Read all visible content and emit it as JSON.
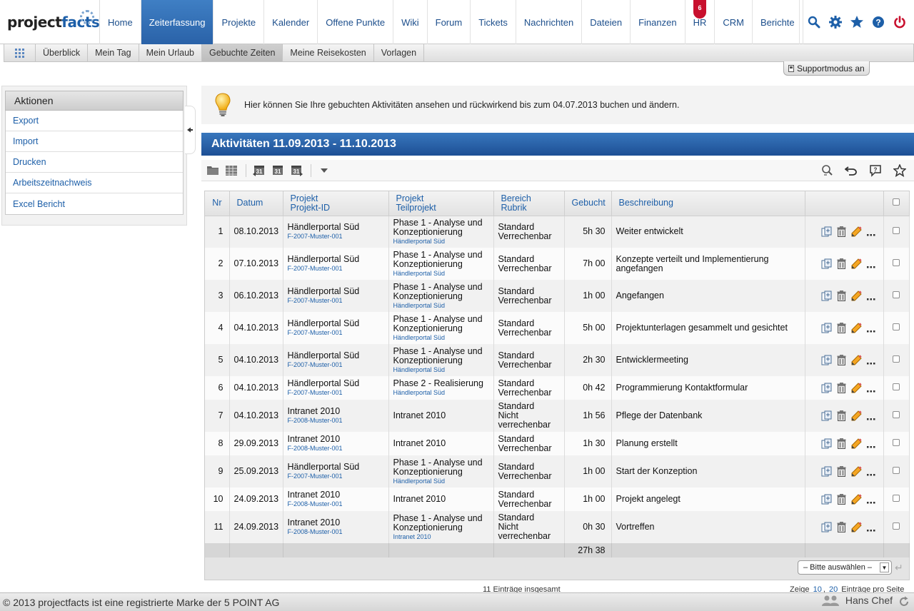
{
  "brand": {
    "part1": "project",
    "part2": "facts"
  },
  "nav": {
    "items": [
      {
        "label": "Home"
      },
      {
        "label": "Zeiterfassung",
        "active": true
      },
      {
        "label": "Projekte"
      },
      {
        "label": "Kalender"
      },
      {
        "label": "Offene Punkte"
      },
      {
        "label": "Wiki"
      },
      {
        "label": "Forum"
      },
      {
        "label": "Tickets"
      },
      {
        "label": "Nachrichten"
      },
      {
        "label": "Dateien"
      },
      {
        "label": "Finanzen"
      },
      {
        "label": "HR",
        "badge": "6"
      },
      {
        "label": "CRM"
      },
      {
        "label": "Berichte"
      }
    ],
    "tools": [
      "search-icon",
      "gear-icon",
      "star-icon",
      "help-icon",
      "power-icon"
    ]
  },
  "subnav": {
    "items": [
      {
        "label": "Überblick"
      },
      {
        "label": "Mein Tag"
      },
      {
        "label": "Mein Urlaub"
      },
      {
        "label": "Gebuchte Zeiten",
        "active": true
      },
      {
        "label": "Meine Reisekosten"
      },
      {
        "label": "Vorlagen"
      }
    ]
  },
  "support_label": "Supportmodus an",
  "sidebar": {
    "title": "Aktionen",
    "items": [
      {
        "label": "Export"
      },
      {
        "label": "Import"
      },
      {
        "label": "Drucken"
      },
      {
        "label": "Arbeitszeitnachweis"
      },
      {
        "label": "Excel Bericht"
      }
    ]
  },
  "info": {
    "text": "Hier können Sie Ihre gebuchten Aktivitäten ansehen und rückwirkend bis zum 04.07.2013 buchen und ändern."
  },
  "panel": {
    "title": "Aktivitäten 11.09.2013 - 11.10.2013"
  },
  "table": {
    "headers": {
      "nr": "Nr",
      "datum": "Datum",
      "projekt1": "Projekt",
      "projekt2": "Projekt-ID",
      "teil1": "Projekt",
      "teil2": "Teilprojekt",
      "bereich1": "Bereich",
      "bereich2": "Rubrik",
      "gebucht": "Gebucht",
      "beschreibung": "Beschreibung"
    },
    "rows": [
      {
        "nr": "1",
        "datum": "08.10.2013",
        "projekt": "Händlerportal Süd",
        "projekt_id": "F-2007-Muster-001",
        "teilprojekt": "Phase 1 - Analyse und Konzeptionierung",
        "teilprojekt_sub": "Händlerportal Süd",
        "bereich": "Standard",
        "rubrik": "Verrechenbar",
        "gebucht": "5h 30",
        "beschreibung": "Weiter entwickelt"
      },
      {
        "nr": "2",
        "datum": "07.10.2013",
        "projekt": "Händlerportal Süd",
        "projekt_id": "F-2007-Muster-001",
        "teilprojekt": "Phase 1 - Analyse und Konzeptionierung",
        "teilprojekt_sub": "Händlerportal Süd",
        "bereich": "Standard",
        "rubrik": "Verrechenbar",
        "gebucht": "7h 00",
        "beschreibung": "Konzepte verteilt und Implementierung angefangen"
      },
      {
        "nr": "3",
        "datum": "06.10.2013",
        "projekt": "Händlerportal Süd",
        "projekt_id": "F-2007-Muster-001",
        "teilprojekt": "Phase 1 - Analyse und Konzeptionierung",
        "teilprojekt_sub": "Händlerportal Süd",
        "bereich": "Standard",
        "rubrik": "Verrechenbar",
        "gebucht": "1h 00",
        "beschreibung": "Angefangen"
      },
      {
        "nr": "4",
        "datum": "04.10.2013",
        "projekt": "Händlerportal Süd",
        "projekt_id": "F-2007-Muster-001",
        "teilprojekt": "Phase 1 - Analyse und Konzeptionierung",
        "teilprojekt_sub": "Händlerportal Süd",
        "bereich": "Standard",
        "rubrik": "Verrechenbar",
        "gebucht": "5h 00",
        "beschreibung": "Projektunterlagen gesammelt und gesichtet"
      },
      {
        "nr": "5",
        "datum": "04.10.2013",
        "projekt": "Händlerportal Süd",
        "projekt_id": "F-2007-Muster-001",
        "teilprojekt": "Phase 1 - Analyse und Konzeptionierung",
        "teilprojekt_sub": "Händlerportal Süd",
        "bereich": "Standard",
        "rubrik": "Verrechenbar",
        "gebucht": "2h 30",
        "beschreibung": "Entwicklermeeting"
      },
      {
        "nr": "6",
        "datum": "04.10.2013",
        "projekt": "Händlerportal Süd",
        "projekt_id": "F-2007-Muster-001",
        "teilprojekt": "Phase 2 - Realisierung",
        "teilprojekt_sub": "Händlerportal Süd",
        "bereich": "Standard",
        "rubrik": "Verrechenbar",
        "gebucht": "0h 42",
        "beschreibung": "Programmierung Kontaktformular"
      },
      {
        "nr": "7",
        "datum": "04.10.2013",
        "projekt": "Intranet 2010",
        "projekt_id": "F-2008-Muster-001",
        "teilprojekt": "Intranet 2010",
        "teilprojekt_sub": "",
        "bereich": "Standard",
        "rubrik": "Nicht verrechenbar",
        "gebucht": "1h 56",
        "beschreibung": "Pflege der Datenbank"
      },
      {
        "nr": "8",
        "datum": "29.09.2013",
        "projekt": "Intranet 2010",
        "projekt_id": "F-2008-Muster-001",
        "teilprojekt": "Intranet 2010",
        "teilprojekt_sub": "",
        "bereich": "Standard",
        "rubrik": "Verrechenbar",
        "gebucht": "1h 30",
        "beschreibung": "Planung erstellt"
      },
      {
        "nr": "9",
        "datum": "25.09.2013",
        "projekt": "Händlerportal Süd",
        "projekt_id": "F-2007-Muster-001",
        "teilprojekt": "Phase 1 - Analyse und Konzeptionierung",
        "teilprojekt_sub": "Händlerportal Süd",
        "bereich": "Standard",
        "rubrik": "Verrechenbar",
        "gebucht": "1h 00",
        "beschreibung": "Start der Konzeption"
      },
      {
        "nr": "10",
        "datum": "24.09.2013",
        "projekt": "Intranet 2010",
        "projekt_id": "F-2008-Muster-001",
        "teilprojekt": "Intranet 2010",
        "teilprojekt_sub": "",
        "bereich": "Standard",
        "rubrik": "Verrechenbar",
        "gebucht": "1h 00",
        "beschreibung": "Projekt angelegt"
      },
      {
        "nr": "11",
        "datum": "24.09.2013",
        "projekt": "Intranet 2010",
        "projekt_id": "F-2008-Muster-001",
        "teilprojekt": "Phase 1 - Analyse und Konzeptionierung",
        "teilprojekt_sub": "Intranet 2010",
        "bereich": "Standard",
        "rubrik": "Nicht verrechenbar",
        "gebucht": "0h 30",
        "beschreibung": "Vortreffen"
      }
    ],
    "total": "27h 38",
    "bulk_select": "– Bitte auswählen –"
  },
  "pager": {
    "count": "11 Einträge insgesamt",
    "show_label": "Zeige",
    "opt1": "10",
    "sep": ",",
    "opt2": "20",
    "per_page": "Einträge pro Seite"
  },
  "footer": {
    "copyright": "© 2013 projectfacts ist eine registrierte Marke der 5 POINT AG",
    "user": "Hans Chef"
  },
  "colors": {
    "brand_blue": "#1d5fa8",
    "nav_active": "#2a62a8",
    "badge_red": "#c8102e"
  }
}
